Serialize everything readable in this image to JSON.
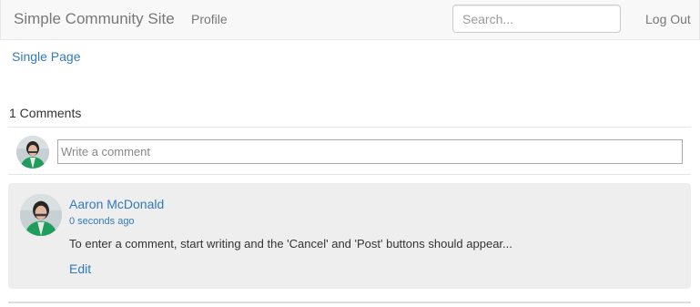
{
  "navbar": {
    "brand": "Simple Community Site",
    "profile_label": "Profile",
    "search_placeholder": "Search...",
    "logout_label": "Log Out"
  },
  "page": {
    "link_label": "Single Page"
  },
  "comments": {
    "count_label": "1 Comments",
    "input_placeholder": "Write a comment",
    "items": [
      {
        "author": "Aaron McDonald",
        "timestamp": "0 seconds ago",
        "text": "To enter a comment, start writing and the 'Cancel' and 'Post' buttons should appear...",
        "edit_label": "Edit",
        "avatar_icon": "user-avatar-icon"
      }
    ]
  },
  "colors": {
    "link": "#337ab7",
    "navbar_bg": "#f8f8f8",
    "comment_bg": "#eeeeee",
    "avatar_jacket": "#1e9e5a"
  }
}
